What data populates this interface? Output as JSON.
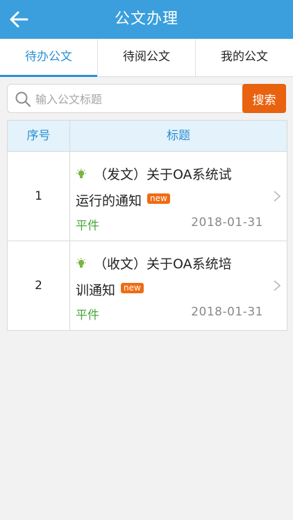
{
  "header": {
    "title": "公文办理",
    "back_icon": "arrow-left-icon"
  },
  "tabs": [
    {
      "label": "待办公文",
      "active": true
    },
    {
      "label": "待阅公文",
      "active": false
    },
    {
      "label": "我的公文",
      "active": false
    }
  ],
  "search": {
    "placeholder": "输入公文标题",
    "value": "",
    "button_label": "搜索"
  },
  "table": {
    "headers": {
      "number": "序号",
      "title": "标题"
    },
    "rows": [
      {
        "number": "1",
        "title_line1": "（发文）关于OA系统试",
        "title_line2": "运行的通知",
        "badge": "new",
        "grade": "平件",
        "date": "2018-01-31"
      },
      {
        "number": "2",
        "title_line1": "（收文）关于OA系统培",
        "title_line2": "训通知",
        "badge": "new",
        "grade": "平件",
        "date": "2018-01-31"
      }
    ]
  },
  "colors": {
    "header_bg": "#3a9fdc",
    "accent": "#2b8fd3",
    "search_button": "#e8620f",
    "badge": "#ef6b14",
    "grade_text": "#49a53a",
    "bulb": "#7cb342"
  }
}
